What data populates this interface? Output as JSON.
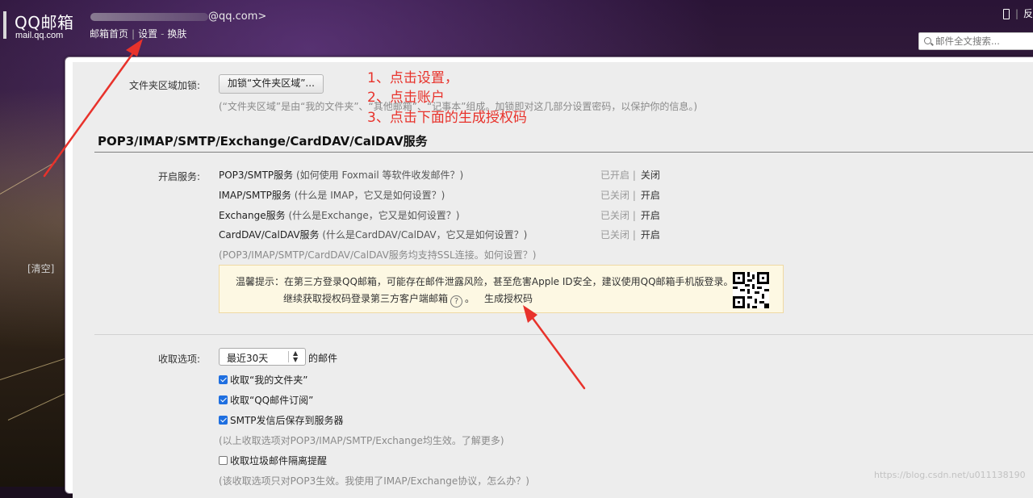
{
  "header": {
    "logo_title": "QQ邮箱",
    "logo_sub": "mail.qq.com",
    "account_text": "@qq.com>",
    "nav": [
      "邮箱首页",
      "设置",
      "换肤"
    ],
    "top_right": "反",
    "search_placeholder": "邮件全文搜索..."
  },
  "sidebar": {
    "clear_label": "[清空]"
  },
  "folder_lock": {
    "label": "文件夹区域加锁:",
    "button": "加锁“文件夹区域”...",
    "hint": "(“文件夹区域”是由“我的文件夹”、“其他邮箱”、“记事本”组成。加锁即对这几部分设置密码，以保护你的信息。)"
  },
  "annotations": [
    "1、点击设置，",
    "2、点击账户",
    "3、点击下面的生成授权码"
  ],
  "services": {
    "title": "POP3/IMAP/SMTP/Exchange/CardDAV/CalDAV服务",
    "label": "开启服务:",
    "rows": [
      {
        "name": "POP3/SMTP服务",
        "question": "(如何使用 Foxmail 等软件收发邮件？)",
        "status": "已开启 |",
        "action": "关闭"
      },
      {
        "name": "IMAP/SMTP服务",
        "question": "(什么是 IMAP，它又是如何设置？)",
        "status": "已关闭 |",
        "action": "开启"
      },
      {
        "name": "Exchange服务",
        "question": "(什么是Exchange，它又是如何设置？)",
        "status": "已关闭 |",
        "action": "开启"
      },
      {
        "name": "CardDAV/CalDAV服务",
        "question": "(什么是CardDAV/CalDAV，它又是如何设置？)",
        "status": "已关闭 |",
        "action": "开启"
      }
    ],
    "ssl_note": "(POP3/IMAP/SMTP/CardDAV/CalDAV服务均支持SSL连接。如何设置？)",
    "notice_line1": "温馨提示：在第三方登录QQ邮箱，可能存在邮件泄露风险，甚至危害Apple ID安全，建议使用QQ邮箱手机版登录。",
    "notice_line2": "继续获取授权码登录第三方客户端邮箱",
    "notice_after_help": "。",
    "generate_code": "生成授权码"
  },
  "receive": {
    "label": "收取选项:",
    "select_value": "最近30天",
    "select_suffix": "的邮件",
    "checks": [
      {
        "label": "收取“我的文件夹”",
        "checked": true
      },
      {
        "label": "收取“QQ邮件订阅”",
        "checked": true
      },
      {
        "label": "SMTP发信后保存到服务器",
        "checked": true
      }
    ],
    "note1": "(以上收取选项对POP3/IMAP/SMTP/Exchange均生效。了解更多)",
    "spam_label": "收取垃圾邮件隔离提醒",
    "spam_checked": false,
    "note2": "(该收取选项只对POP3生效。我使用了IMAP/Exchange协议，怎么办？)"
  },
  "watermark": "https://blog.csdn.net/u011138190",
  "colors": {
    "annotation": "#e8322b",
    "checkbox": "#1f6fe0",
    "notice_bg": "#fdf8e3"
  }
}
